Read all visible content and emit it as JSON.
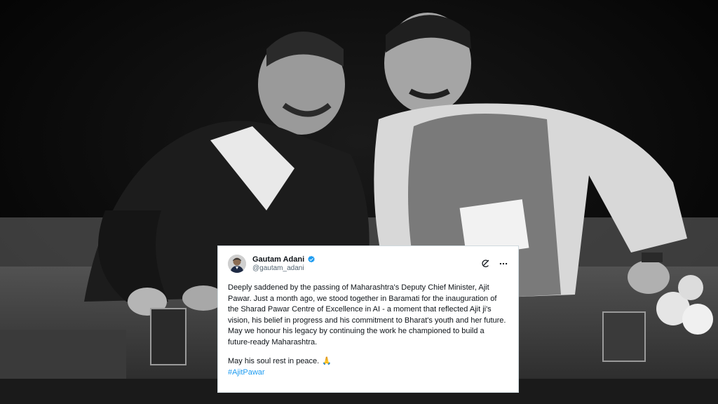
{
  "tweet": {
    "author_name": "Gautam Adani",
    "author_handle": "@gautam_adani",
    "body_paragraph_1": "Deeply saddened by the passing of Maharashtra's Deputy Chief Minister, Ajit Pawar. Just a month ago, we stood together in Baramati for the inauguration of the Sharad Pawar Centre of Excellence in AI - a moment that reflected Ajit ji's vision, his belief in progress and his commitment to Bharat's youth and her future. May we honour his legacy by continuing the work he championed to build a future-ready Maharashtra.",
    "body_paragraph_2": "May his soul rest in peace.",
    "emoji": "🙏",
    "hashtag": "#AjitPawar"
  },
  "photo": {
    "subject": "black-and-white photo of two men seated and conversing on stage"
  },
  "colors": {
    "link_blue": "#1d9bf0",
    "verified_blue": "#1d9bf0",
    "text_primary": "#0f1419",
    "text_secondary": "#536471",
    "card_bg": "#ffffff"
  },
  "icons": {
    "verified": "verified-badge-icon",
    "grok": "grok-icon",
    "more": "more-icon"
  }
}
